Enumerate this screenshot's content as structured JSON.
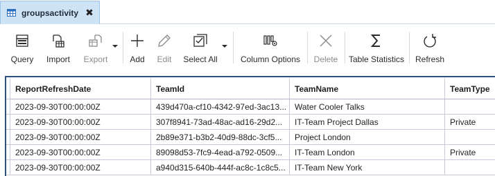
{
  "tab": {
    "title": "groupsactivity",
    "icon": "table-icon",
    "close_glyph": "✖"
  },
  "toolbar": {
    "query_label": "Query",
    "import_label": "Import",
    "export_label": "Export",
    "add_label": "Add",
    "edit_label": "Edit",
    "select_all_label": "Select All",
    "column_options_label": "Column Options",
    "delete_label": "Delete",
    "table_statistics_label": "Table Statistics",
    "refresh_label": "Refresh"
  },
  "table": {
    "columns": [
      "ReportRefreshDate",
      "TeamId",
      "TeamName",
      "TeamType"
    ],
    "rows": [
      [
        "2023-09-30T00:00:00Z",
        "439d470a-cf10-4342-97ed-3ac13...",
        "Water Cooler Talks",
        ""
      ],
      [
        "2023-09-30T00:00:00Z",
        "307f8941-73ad-48ac-ad16-29d2...",
        "IT-Team Project Dallas",
        "Private"
      ],
      [
        "2023-09-30T00:00:00Z",
        "2b89e371-b3b2-40d9-88dc-3cf5...",
        "Project London",
        ""
      ],
      [
        "2023-09-30T00:00:00Z",
        "89098d53-7fc9-4ead-a792-0509...",
        "IT-Team London",
        "Private"
      ],
      [
        "2023-09-30T00:00:00Z",
        "a940d315-640b-444f-ac8c-1c8c5...",
        "IT-Team New York",
        ""
      ]
    ]
  },
  "colors": {
    "tab_active_bg": "#cfe3f7",
    "grid_focus_border": "#2c4f7e",
    "grid_line": "#c9c9d9"
  }
}
